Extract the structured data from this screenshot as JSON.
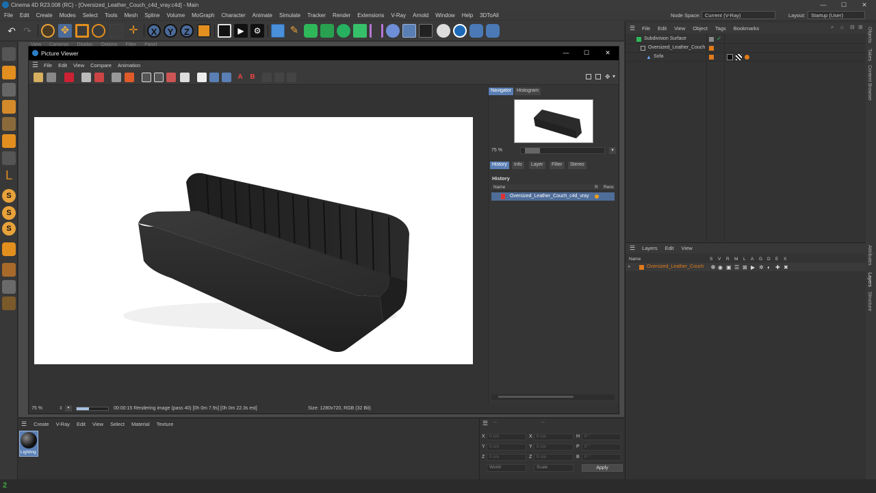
{
  "window": {
    "title": "Cinema 4D R23.008 (RC) - [Oversized_Leather_Couch_c4d_vray.c4d] - Main",
    "minimize": "—",
    "maximize": "☐",
    "close": "✕"
  },
  "menubar": {
    "items": [
      "File",
      "Edit",
      "Create",
      "Modes",
      "Select",
      "Tools",
      "Mesh",
      "Spline",
      "Volume",
      "MoGraph",
      "Character",
      "Animate",
      "Simulate",
      "Tracker",
      "Render",
      "Extensions",
      "V-Ray",
      "Arnold",
      "Window",
      "Help",
      "3DToAll"
    ],
    "node_space_label": "Node Space:",
    "node_space_value": "Current (V-Ray)",
    "layout_label": "Layout:",
    "layout_value": "Startup (User)"
  },
  "picture_viewer": {
    "title": "Picture Viewer",
    "menu": [
      "File",
      "Edit",
      "View",
      "Compare",
      "Animation"
    ],
    "zoom": "75 %",
    "status": "00:00:15 Rendering image (pass 40) [0h  0m  7.9s] [0h  0m  22.3s est]",
    "size_info": "Size: 1280x720, RGB (32 Bit)",
    "navigator_tabs": [
      "Navigator",
      "Histogram"
    ],
    "nav_zoom": "75 %",
    "history_tabs": [
      "History",
      "Info",
      "Layer",
      "Filter",
      "Stereo"
    ],
    "history_heading": "History",
    "history_columns": {
      "name": "Name",
      "r": "R",
      "render": "Renc"
    },
    "history_rows": [
      {
        "name": "Oversized_Leather_Couch_c4d_vray"
      }
    ]
  },
  "object_manager": {
    "menu": [
      "File",
      "Edit",
      "View",
      "Object",
      "Tags",
      "Bookmarks"
    ],
    "objects": [
      {
        "name": "Subdivision Surface"
      },
      {
        "name": "Oversized_Leather_Couch"
      },
      {
        "name": "Sofa"
      }
    ]
  },
  "layer_manager": {
    "title": "Layers",
    "menu": [
      "Edit",
      "View"
    ],
    "name_header": "Name",
    "flags": [
      "S",
      "V",
      "R",
      "M",
      "L",
      "A",
      "G",
      "D",
      "E",
      "X"
    ],
    "layers": [
      {
        "name": "Oversized_Leather_Couch"
      }
    ]
  },
  "side_tabs": [
    "Objects",
    "Takes",
    "Content Browser",
    "Attributes",
    "Layers",
    "Structure"
  ],
  "viewport_menu": [
    "View",
    "Cameras",
    "Display",
    "Options",
    "Filter",
    "Panel"
  ],
  "material_manager": {
    "menu": [
      "Create",
      "V-Ray",
      "Edit",
      "View",
      "Select",
      "Material",
      "Texture"
    ],
    "materials": [
      {
        "name": "Lighting"
      }
    ]
  },
  "coordinates": {
    "pos_label": "X",
    "rows": [
      {
        "a": "X",
        "av": "0 cm",
        "b": "X",
        "bv": "0 cm",
        "c": "H",
        "cv": "0 °"
      },
      {
        "a": "Y",
        "av": "0 cm",
        "b": "Y",
        "bv": "0 cm",
        "c": "P",
        "cv": "0 °"
      },
      {
        "a": "Z",
        "av": "0 cm",
        "b": "Z",
        "bv": "0 cm",
        "c": "B",
        "cv": "0 °"
      }
    ],
    "world": "World",
    "scale": "Scale",
    "apply": "Apply",
    "header_left": "--",
    "header_right": "--"
  },
  "colors": {
    "accent": "#5a7fb5",
    "orange": "#e07a1a",
    "couch": "#2e2e2e"
  }
}
